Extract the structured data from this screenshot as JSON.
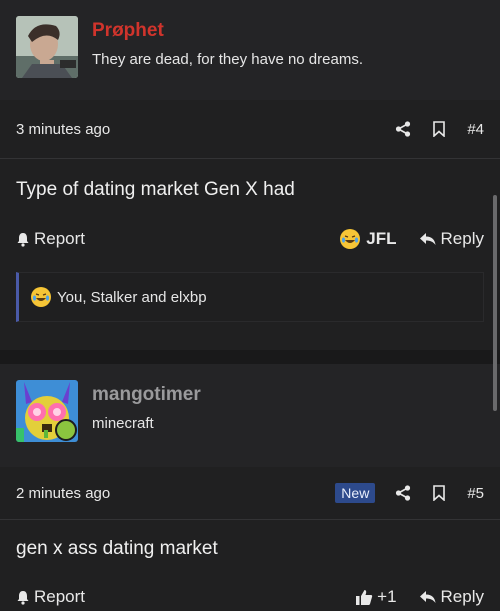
{
  "posts": [
    {
      "username": "Prøphet",
      "username_color": "#d0342c",
      "user_title": "They are dead, for they have no dreams.",
      "time": "3 minutes ago",
      "post_number": "#4",
      "message": "Type of dating market Gen X had",
      "report_label": "Report",
      "reaction_label": "JFL",
      "reply_label": "Reply",
      "reactions_summary": "You, Stalker and elxbp"
    },
    {
      "username": "mangotimer",
      "username_color": "#9a9a9c",
      "user_title": "minecraft",
      "time": "2 minutes ago",
      "badge": "New",
      "post_number": "#5",
      "message": "gen x ass dating market",
      "report_label": "Report",
      "like_label": "+1",
      "reply_label": "Reply"
    }
  ],
  "icons": {
    "share": "share-icon",
    "bookmark": "bookmark-icon",
    "bell": "bell-icon",
    "reply": "reply-arrow-icon",
    "like": "thumbs-up-icon",
    "laugh": "laughing-emoji-icon"
  }
}
